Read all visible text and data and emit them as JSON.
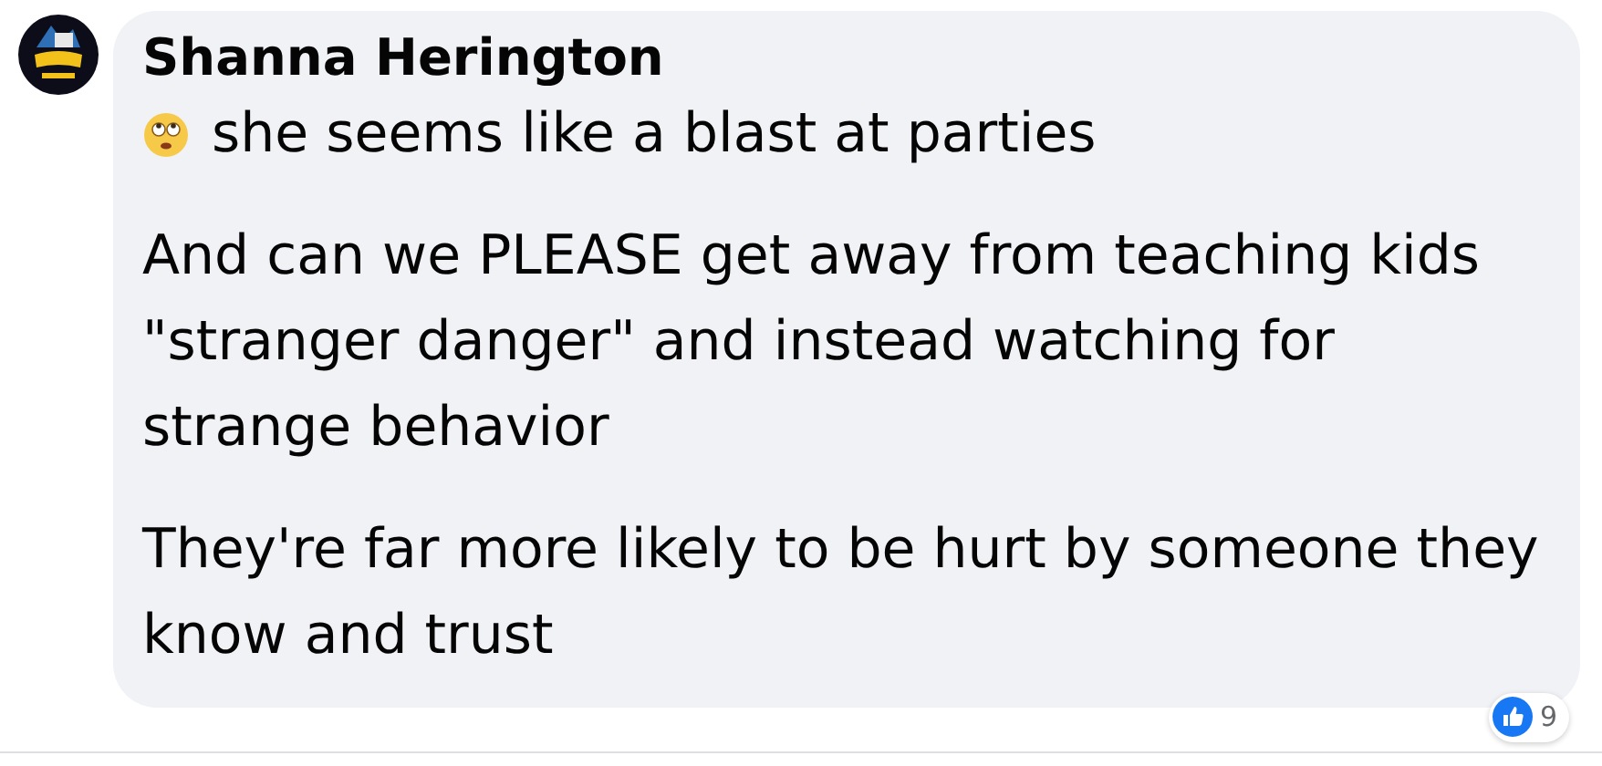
{
  "comment": {
    "author": "Shanna Herington",
    "paragraphs": [
      "she seems like a blast at parties",
      "And can we PLEASE get away from teaching kids \"stranger danger\" and instead watching for strange behavior",
      "They're far more likely to be hurt by someone they know and trust"
    ],
    "reaction_count": "9"
  }
}
